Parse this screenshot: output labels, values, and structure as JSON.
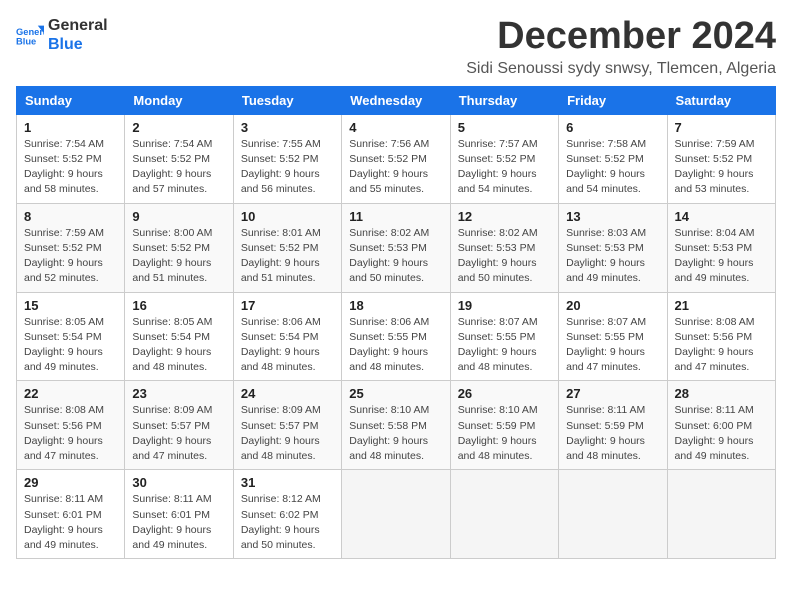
{
  "logo": {
    "line1": "General",
    "line2": "Blue"
  },
  "title": "December 2024",
  "subtitle": "Sidi Senoussi sydy snwsy, Tlemcen, Algeria",
  "headers": [
    "Sunday",
    "Monday",
    "Tuesday",
    "Wednesday",
    "Thursday",
    "Friday",
    "Saturday"
  ],
  "weeks": [
    [
      {
        "day": "1",
        "sunrise": "7:54 AM",
        "sunset": "5:52 PM",
        "daylight": "9 hours and 58 minutes."
      },
      {
        "day": "2",
        "sunrise": "7:54 AM",
        "sunset": "5:52 PM",
        "daylight": "9 hours and 57 minutes."
      },
      {
        "day": "3",
        "sunrise": "7:55 AM",
        "sunset": "5:52 PM",
        "daylight": "9 hours and 56 minutes."
      },
      {
        "day": "4",
        "sunrise": "7:56 AM",
        "sunset": "5:52 PM",
        "daylight": "9 hours and 55 minutes."
      },
      {
        "day": "5",
        "sunrise": "7:57 AM",
        "sunset": "5:52 PM",
        "daylight": "9 hours and 54 minutes."
      },
      {
        "day": "6",
        "sunrise": "7:58 AM",
        "sunset": "5:52 PM",
        "daylight": "9 hours and 54 minutes."
      },
      {
        "day": "7",
        "sunrise": "7:59 AM",
        "sunset": "5:52 PM",
        "daylight": "9 hours and 53 minutes."
      }
    ],
    [
      {
        "day": "8",
        "sunrise": "7:59 AM",
        "sunset": "5:52 PM",
        "daylight": "9 hours and 52 minutes."
      },
      {
        "day": "9",
        "sunrise": "8:00 AM",
        "sunset": "5:52 PM",
        "daylight": "9 hours and 51 minutes."
      },
      {
        "day": "10",
        "sunrise": "8:01 AM",
        "sunset": "5:52 PM",
        "daylight": "9 hours and 51 minutes."
      },
      {
        "day": "11",
        "sunrise": "8:02 AM",
        "sunset": "5:53 PM",
        "daylight": "9 hours and 50 minutes."
      },
      {
        "day": "12",
        "sunrise": "8:02 AM",
        "sunset": "5:53 PM",
        "daylight": "9 hours and 50 minutes."
      },
      {
        "day": "13",
        "sunrise": "8:03 AM",
        "sunset": "5:53 PM",
        "daylight": "9 hours and 49 minutes."
      },
      {
        "day": "14",
        "sunrise": "8:04 AM",
        "sunset": "5:53 PM",
        "daylight": "9 hours and 49 minutes."
      }
    ],
    [
      {
        "day": "15",
        "sunrise": "8:05 AM",
        "sunset": "5:54 PM",
        "daylight": "9 hours and 49 minutes."
      },
      {
        "day": "16",
        "sunrise": "8:05 AM",
        "sunset": "5:54 PM",
        "daylight": "9 hours and 48 minutes."
      },
      {
        "day": "17",
        "sunrise": "8:06 AM",
        "sunset": "5:54 PM",
        "daylight": "9 hours and 48 minutes."
      },
      {
        "day": "18",
        "sunrise": "8:06 AM",
        "sunset": "5:55 PM",
        "daylight": "9 hours and 48 minutes."
      },
      {
        "day": "19",
        "sunrise": "8:07 AM",
        "sunset": "5:55 PM",
        "daylight": "9 hours and 48 minutes."
      },
      {
        "day": "20",
        "sunrise": "8:07 AM",
        "sunset": "5:55 PM",
        "daylight": "9 hours and 47 minutes."
      },
      {
        "day": "21",
        "sunrise": "8:08 AM",
        "sunset": "5:56 PM",
        "daylight": "9 hours and 47 minutes."
      }
    ],
    [
      {
        "day": "22",
        "sunrise": "8:08 AM",
        "sunset": "5:56 PM",
        "daylight": "9 hours and 47 minutes."
      },
      {
        "day": "23",
        "sunrise": "8:09 AM",
        "sunset": "5:57 PM",
        "daylight": "9 hours and 47 minutes."
      },
      {
        "day": "24",
        "sunrise": "8:09 AM",
        "sunset": "5:57 PM",
        "daylight": "9 hours and 48 minutes."
      },
      {
        "day": "25",
        "sunrise": "8:10 AM",
        "sunset": "5:58 PM",
        "daylight": "9 hours and 48 minutes."
      },
      {
        "day": "26",
        "sunrise": "8:10 AM",
        "sunset": "5:59 PM",
        "daylight": "9 hours and 48 minutes."
      },
      {
        "day": "27",
        "sunrise": "8:11 AM",
        "sunset": "5:59 PM",
        "daylight": "9 hours and 48 minutes."
      },
      {
        "day": "28",
        "sunrise": "8:11 AM",
        "sunset": "6:00 PM",
        "daylight": "9 hours and 49 minutes."
      }
    ],
    [
      {
        "day": "29",
        "sunrise": "8:11 AM",
        "sunset": "6:01 PM",
        "daylight": "9 hours and 49 minutes."
      },
      {
        "day": "30",
        "sunrise": "8:11 AM",
        "sunset": "6:01 PM",
        "daylight": "9 hours and 49 minutes."
      },
      {
        "day": "31",
        "sunrise": "8:12 AM",
        "sunset": "6:02 PM",
        "daylight": "9 hours and 50 minutes."
      },
      null,
      null,
      null,
      null
    ]
  ],
  "labels": {
    "sunrise": "Sunrise:",
    "sunset": "Sunset:",
    "daylight": "Daylight:"
  }
}
